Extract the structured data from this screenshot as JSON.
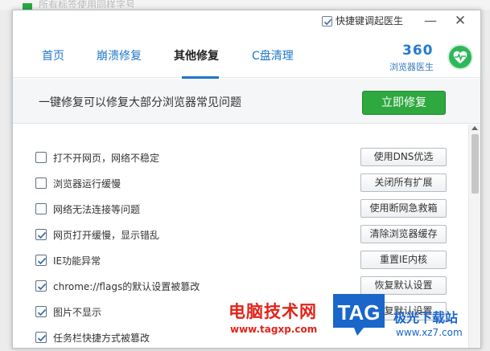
{
  "background": {
    "partial_text": "所有标签使用同样字号"
  },
  "window": {
    "hotkey_label": "快捷键调起医生",
    "hotkey_checked": true,
    "minimize_glyph": "—",
    "close_glyph": "✕"
  },
  "tabs": [
    {
      "label": "首页",
      "active": false
    },
    {
      "label": "崩溃修复",
      "active": false
    },
    {
      "label": "其他修复",
      "active": true
    },
    {
      "label": "C盘清理",
      "active": false
    }
  ],
  "brand": {
    "number": "360",
    "subtitle": "浏览器医生"
  },
  "header": {
    "headline": "一键修复可以修复大部分浏览器常见问题",
    "fix_button": "立即修复"
  },
  "items": [
    {
      "label": "打不开网页，网络不稳定",
      "checked": false,
      "action": "使用DNS优选"
    },
    {
      "label": "浏览器运行缓慢",
      "checked": false,
      "action": "关闭所有扩展"
    },
    {
      "label": "网络无法连接等问题",
      "checked": false,
      "action": "使用断网急救箱"
    },
    {
      "label": "网页打开缓慢，显示错乱",
      "checked": true,
      "action": "清除浏览器缓存"
    },
    {
      "label": "IE功能异常",
      "checked": true,
      "action": "重置IE内核"
    },
    {
      "label": "chrome://flags的默认设置被篡改",
      "checked": true,
      "action": "恢复默认设置"
    },
    {
      "label": "图片不显示",
      "checked": true,
      "action": "恢复默认设置"
    },
    {
      "label": "任务栏快捷方式被篡改",
      "checked": true,
      "action": ""
    }
  ],
  "watermark": {
    "cn": "电脑技术网",
    "url": "www.tagxp.com",
    "logo": "TAG",
    "site_cn": "极光下载站",
    "site_en": "www.xz7.com"
  },
  "colors": {
    "accent_blue": "#1e76c8",
    "fix_green": "#2ea83f",
    "watermark_red": "#e2241b"
  }
}
